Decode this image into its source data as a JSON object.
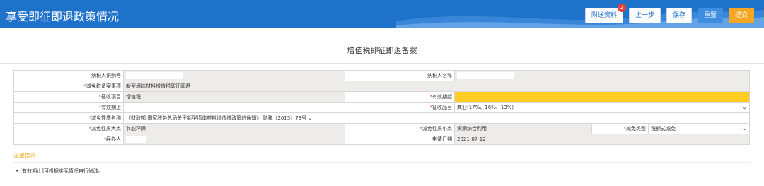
{
  "header": {
    "title": "享受即征即退政策情况",
    "buttons": {
      "attach": "附送资料",
      "attach_badge": "2",
      "prev": "上一步",
      "save": "保存",
      "reset": "重置",
      "submit": "提交"
    }
  },
  "form": {
    "title": "增值税即征即退备案",
    "taxpayer_id_label": "纳税人识别号",
    "taxpayer_name_label": "纳税人名称",
    "item_label": "减免税备案事项",
    "item_value": "新型墙体材料增值税即征即退",
    "levy_project_label": "征收项目",
    "levy_project_value": "增值税",
    "valid_start_label": "有效期起",
    "valid_end_label": "有效期止",
    "levy_item_label": "征收品目",
    "levy_item_value": "商业(17%、16%、13%)",
    "nature_name_label": "减免性质名称",
    "nature_name_value": "《财政部 国家税务总局关于新型墙体材料增值税政策的通知》 财税〔2015〕73号",
    "category_label": "减免性质大类",
    "category_value": "节能环保",
    "subcategory_label": "减免性质小类",
    "subcategory_value": "资源综合利用",
    "type_label": "减免类型",
    "type_value": "税额式减免",
    "handler_label": "经办人",
    "apply_date_label": "申请日期",
    "apply_date_value": "2021-07-12",
    "required_mark": "*"
  },
  "tips": {
    "title": "温馨提示",
    "items": [
      "[有效期止]可根据实际情况自行修改。"
    ]
  },
  "colors": {
    "header": "#1f72c9",
    "submit": "#f5a623",
    "highlight": "#ffcc22",
    "required": "#e8413c"
  }
}
